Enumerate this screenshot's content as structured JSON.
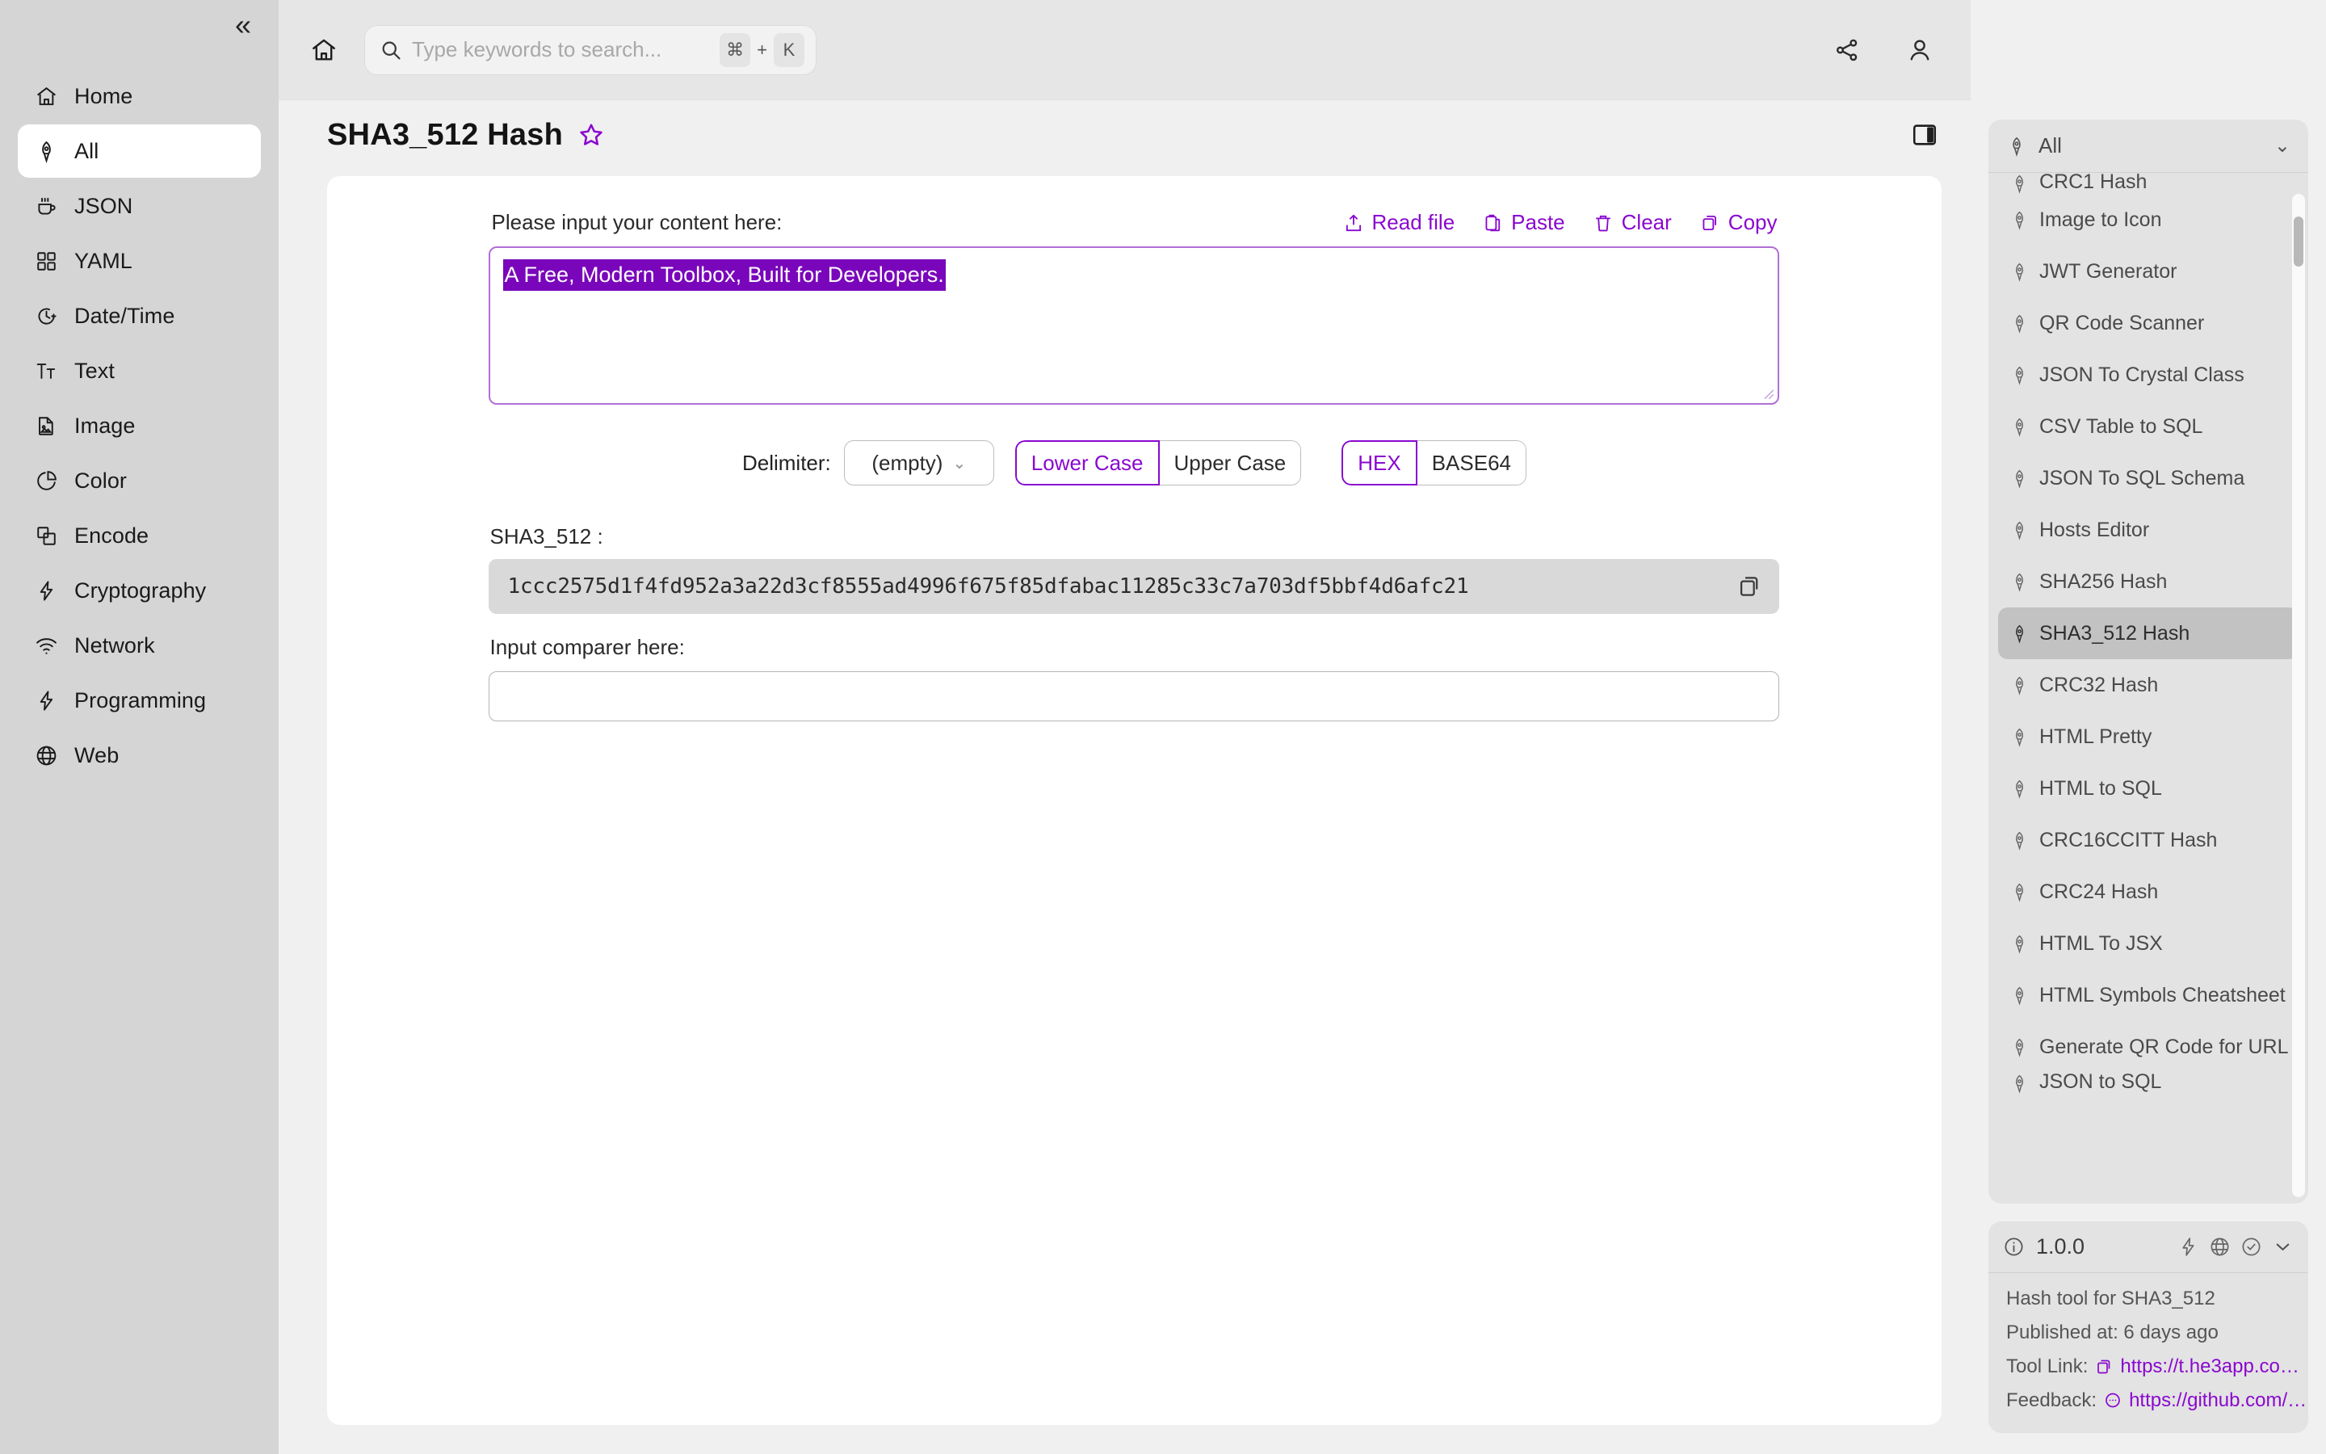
{
  "sidebar": {
    "collapse_icon": "double-chevron-left-icon",
    "items": [
      {
        "label": "Home",
        "icon": "home-icon",
        "active": false
      },
      {
        "label": "All",
        "icon": "rocket-icon",
        "active": true
      },
      {
        "label": "JSON",
        "icon": "coffee-cup-icon",
        "active": false
      },
      {
        "label": "YAML",
        "icon": "grid-icon",
        "active": false
      },
      {
        "label": "Date/Time",
        "icon": "clock-icon",
        "active": false
      },
      {
        "label": "Text",
        "icon": "text-format-icon",
        "active": false
      },
      {
        "label": "Image",
        "icon": "image-icon",
        "active": false
      },
      {
        "label": "Color",
        "icon": "pie-chart-icon",
        "active": false
      },
      {
        "label": "Encode",
        "icon": "layers-icon",
        "active": false
      },
      {
        "label": "Cryptography",
        "icon": "lightning-icon",
        "active": false
      },
      {
        "label": "Network",
        "icon": "wifi-icon",
        "active": false
      },
      {
        "label": "Programming",
        "icon": "lightning-icon",
        "active": false
      },
      {
        "label": "Web",
        "icon": "globe-icon",
        "active": false
      }
    ]
  },
  "topbar": {
    "home_icon": "home-icon",
    "search": {
      "placeholder": "Type keywords to search...",
      "value": "",
      "icon": "search-icon"
    },
    "shortcut": {
      "key_modifier": "⌘",
      "plus": "+",
      "key": "K"
    },
    "share_icon": "share-icon",
    "account_icon": "user-icon"
  },
  "page": {
    "title": "SHA3_512 Hash",
    "favorite_icon": "star-outline-icon",
    "panel_toggle_icon": "right-panel-toggle-icon"
  },
  "main": {
    "input_label": "Please input your content here:",
    "actions": [
      {
        "label": "Read file",
        "icon": "upload-icon"
      },
      {
        "label": "Paste",
        "icon": "paste-icon"
      },
      {
        "label": "Clear",
        "icon": "trash-icon"
      },
      {
        "label": "Copy",
        "icon": "copy-icon"
      }
    ],
    "input_value": "A Free, Modern Toolbox, Built for Developers.",
    "delimiter_label": "Delimiter:",
    "delimiter_value": "(empty)",
    "case_options": [
      {
        "label": "Lower Case",
        "selected": true
      },
      {
        "label": "Upper Case",
        "selected": false
      }
    ],
    "format_options": [
      {
        "label": "HEX",
        "selected": true
      },
      {
        "label": "BASE64",
        "selected": false
      }
    ],
    "result_label": "SHA3_512 :",
    "result_value": "1ccc2575d1f4fd952a3a22d3cf8555ad4996f675f85dfabac11285c33c7a703df5bbf4d6afc21",
    "result_copy_icon": "copy-icon",
    "comparer_label": "Input comparer here:",
    "comparer_value": "",
    "comparer_placeholder": ""
  },
  "rightpanel": {
    "filter": {
      "label": "All",
      "icon": "rocket-icon",
      "chevron": "chevron-down-icon"
    },
    "tools": [
      {
        "label": "CRC1 Hash",
        "selected": false,
        "clipped": true
      },
      {
        "label": "Image to Icon",
        "selected": false
      },
      {
        "label": "JWT Generator",
        "selected": false
      },
      {
        "label": "QR Code Scanner",
        "selected": false
      },
      {
        "label": "JSON To Crystal Class",
        "selected": false
      },
      {
        "label": "CSV Table to SQL",
        "selected": false
      },
      {
        "label": "JSON To SQL Schema",
        "selected": false
      },
      {
        "label": "Hosts Editor",
        "selected": false
      },
      {
        "label": "SHA256 Hash",
        "selected": false
      },
      {
        "label": "SHA3_512 Hash",
        "selected": true
      },
      {
        "label": "CRC32 Hash",
        "selected": false
      },
      {
        "label": "HTML Pretty",
        "selected": false
      },
      {
        "label": "HTML to SQL",
        "selected": false
      },
      {
        "label": "CRC16CCITT Hash",
        "selected": false
      },
      {
        "label": "CRC24 Hash",
        "selected": false
      },
      {
        "label": "HTML To JSX",
        "selected": false
      },
      {
        "label": "HTML Symbols Cheatsheet",
        "selected": false
      },
      {
        "label": "Generate QR Code for URL",
        "selected": false
      },
      {
        "label": "JSON to SQL",
        "selected": false,
        "clipped": true
      }
    ],
    "info": {
      "version": "1.0.0",
      "info_icon": "info-circle-icon",
      "head_icons": [
        "lightning-icon",
        "globe-icon",
        "check-circle-icon",
        "chevron-down-icon"
      ],
      "description": "Hash tool for SHA3_512",
      "published": "Published at: 6 days ago",
      "tool_link_label": "Tool Link:",
      "tool_link_value": "https://t.he3app.co…",
      "feedback_label": "Feedback:",
      "feedback_value": "https://github.com/…"
    }
  },
  "colors": {
    "accent": "#8a08cf",
    "selection": "#7a06bb",
    "sidebar_bg": "#d5d5d5",
    "page_bg": "#f0f0f0",
    "card_bg": "#ffffff"
  }
}
